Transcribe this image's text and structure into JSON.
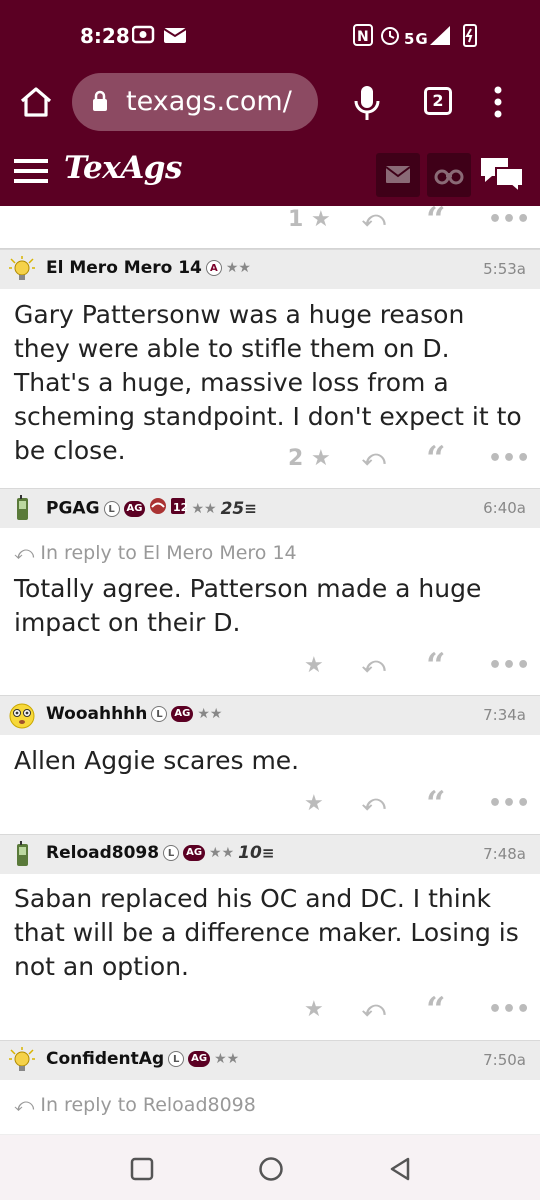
{
  "status": {
    "time": "8:28",
    "network": "5G"
  },
  "browser": {
    "url": "texags.com/",
    "tab_count": "2"
  },
  "site": {
    "logo": "TexAgs"
  },
  "prev_post": {
    "likes": "1"
  },
  "posts": [
    {
      "username": "El Mero Mero 14",
      "avatar": "lightbulb-icon",
      "badges": [
        "A"
      ],
      "stars": "★★",
      "time": "5:53a",
      "text": "Gary Pattersonw was a huge reason they were able to stifle them on D. That's a huge, massive loss from a scheming standpoint. I don't expect it to be close.",
      "likes": "2"
    },
    {
      "username": "PGAG",
      "avatar": "phone-icon",
      "badges": [
        "L",
        "AG"
      ],
      "stars": "★★",
      "level": "25",
      "time": "6:40a",
      "reply_to": "In reply to El Mero Mero 14",
      "text": "Totally agree. Patterson made a huge impact on their D."
    },
    {
      "username": "Wooahhhh",
      "avatar": "emoji-face-icon",
      "badges": [
        "L",
        "AG"
      ],
      "stars": "★★",
      "time": "7:34a",
      "text": "Allen Aggie scares me."
    },
    {
      "username": "Reload8098",
      "avatar": "phone-icon",
      "badges": [
        "L",
        "AG"
      ],
      "stars": "★★",
      "level": "10",
      "time": "7:48a",
      "text": "Saban replaced his OC and DC. I think that will be a difference maker. Losing is not an option."
    },
    {
      "username": "ConfidentAg",
      "avatar": "lightbulb-icon",
      "badges": [
        "L",
        "AG"
      ],
      "stars": "★★",
      "time": "7:50a",
      "reply_to": "In reply to Reload8098"
    }
  ],
  "colors": {
    "brand": "#5b0023",
    "header_row": "#ececec",
    "action_gray": "#bbbbbb"
  }
}
